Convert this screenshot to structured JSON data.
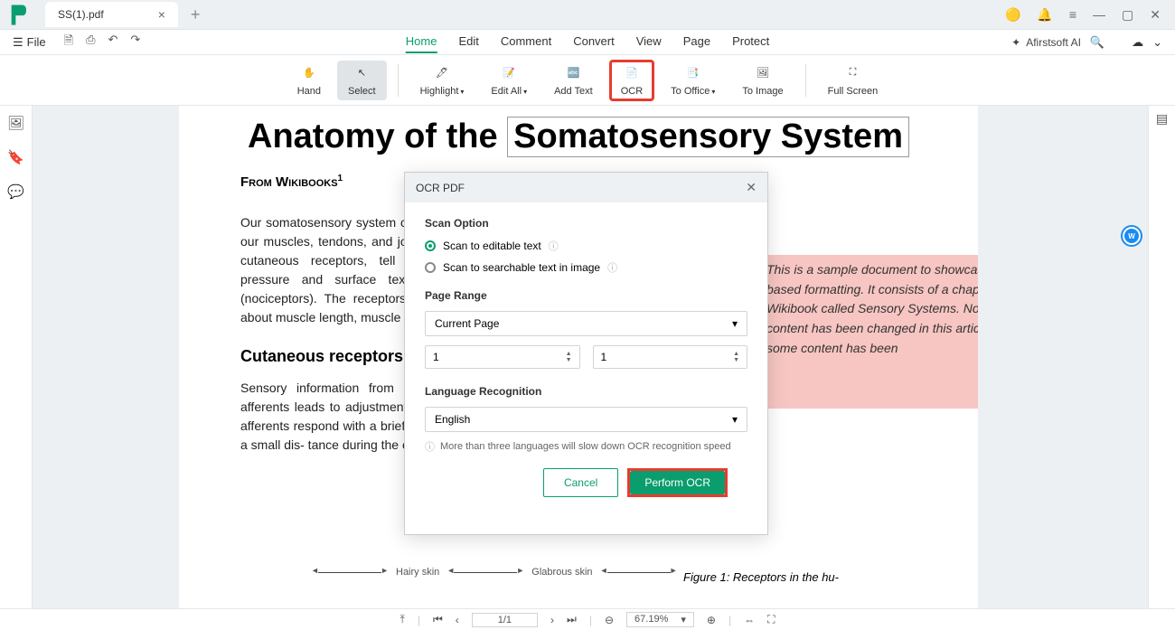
{
  "titlebar": {
    "tab_name": "SS(1).pdf"
  },
  "menubar": {
    "file_label": "File",
    "tabs": [
      "Home",
      "Edit",
      "Comment",
      "Convert",
      "View",
      "Page",
      "Protect"
    ],
    "active_tab": 0,
    "ai_label": "Afirstsoft AI"
  },
  "toolbar": {
    "hand": "Hand",
    "select": "Select",
    "highlight": "Highlight",
    "edit_all": "Edit All",
    "add_text": "Add Text",
    "ocr": "OCR",
    "to_office": "To Office",
    "to_image": "To Image",
    "full_screen": "Full Screen"
  },
  "document": {
    "title_p1": "Anatomy of the ",
    "title_p2": "Somatosensory System",
    "subtitle": "From Wikibooks",
    "para1": "Our somatosensory system consists of sensors in the skin and sensors in our muscles, tendons, and joints. The receptors in the skin, the so called cutaneous receptors, tell us about temperature (thermoreceptors), pressure and surface texture ( mechano rec eptors), and pain (nociceptors). The receptors in muscles and joints provide information about muscle length, muscle tension, and joint angles.",
    "section_header": "Cutaneous receptors",
    "para2": "Sensory information from Meissner corpuscles and rapidly adapting afferents leads to adjustment of grip force when objects are lifted. These afferents respond with a brief burst of action potentials when objects move a small dis- tance during the early stages of lifting. In response to",
    "fig_caption": "Figure 1:   Receptors in the hu-",
    "skin1": "Hairy skin",
    "skin2": "Glabrous skin",
    "sample_note": "This is a sample document to showcase page-based formatting. It consists of a chapter from a Wikibook called Sensory Systems. None of the content has been changed in this article, but some content has been"
  },
  "dialog": {
    "title": "OCR PDF",
    "scan_option_label": "Scan Option",
    "radio1": "Scan to editable text",
    "radio2": "Scan to searchable text in image",
    "page_range_label": "Page Range",
    "range_option": "Current Page",
    "range_from": "1",
    "range_to": "1",
    "lang_label": "Language Recognition",
    "lang_option": "English",
    "help_text": "More than three languages will slow down OCR recognition speed",
    "cancel": "Cancel",
    "perform": "Perform OCR"
  },
  "bottombar": {
    "page": "1/1",
    "zoom": "67.19%"
  }
}
